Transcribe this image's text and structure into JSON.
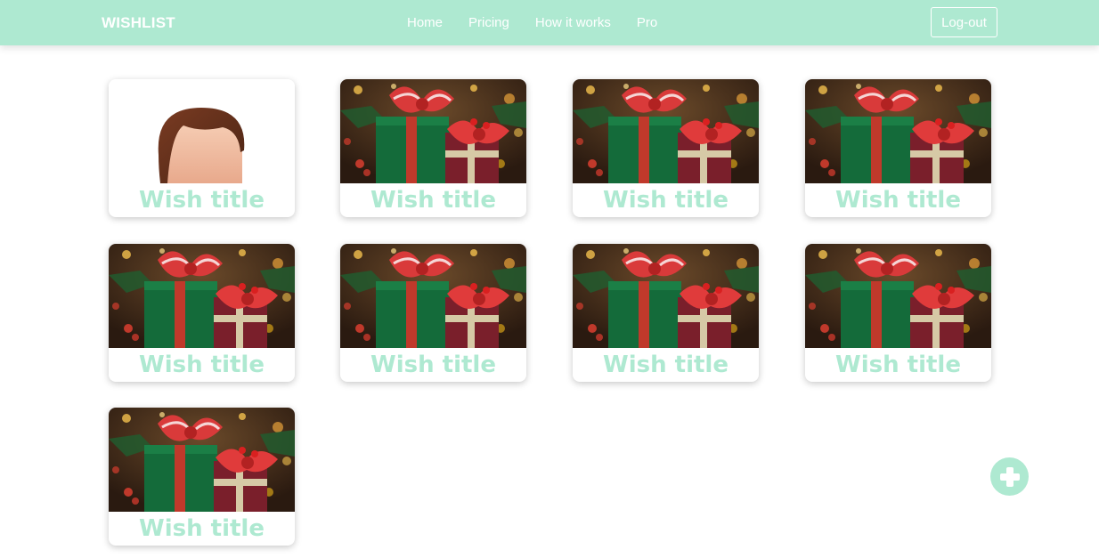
{
  "brand": "WISHLIST",
  "nav": {
    "items": [
      "Home",
      "Pricing",
      "How it works",
      "Pro"
    ],
    "logout_label": "Log-out"
  },
  "cards": [
    {
      "title": "Wish title",
      "image": "avatar-placeholder"
    },
    {
      "title": "Wish title",
      "image": "christmas-gifts-photo"
    },
    {
      "title": "Wish title",
      "image": "christmas-gifts-photo"
    },
    {
      "title": "Wish title",
      "image": "christmas-gifts-photo"
    },
    {
      "title": "Wish title",
      "image": "christmas-gifts-photo"
    },
    {
      "title": "Wish title",
      "image": "christmas-gifts-photo"
    },
    {
      "title": "Wish title",
      "image": "christmas-gifts-photo"
    },
    {
      "title": "Wish title",
      "image": "christmas-gifts-photo"
    },
    {
      "title": "Wish title",
      "image": "christmas-gifts-photo"
    }
  ],
  "add_button_icon": "plus-icon",
  "colors": {
    "accent": "#aee9d1",
    "text_on_accent": "#ffffff"
  }
}
